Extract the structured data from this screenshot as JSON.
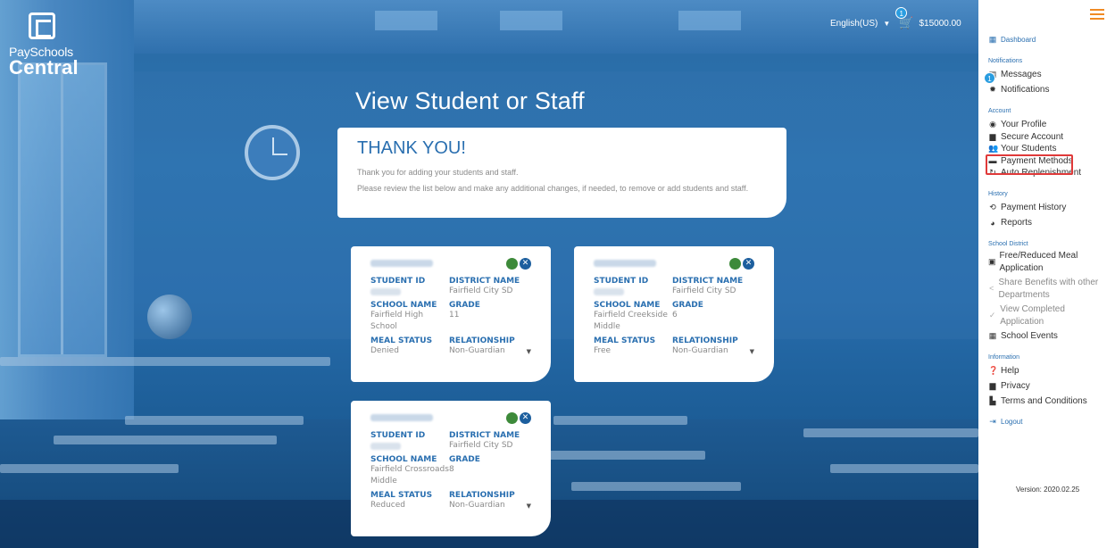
{
  "brand": {
    "line1": "PaySchools",
    "line2": "Central"
  },
  "topbar": {
    "language": "English(US)",
    "cart_total": "$15000.00",
    "cart_badge": "1"
  },
  "page": {
    "title": "View Student or Staff"
  },
  "thanks": {
    "heading": "THANK YOU!",
    "line1": "Thank you for adding your students and staff.",
    "line2": "Please review the list below and make any additional changes, if needed, to remove or add students and staff."
  },
  "labels": {
    "student_id": "STUDENT ID",
    "district_name": "DISTRICT NAME",
    "school_name": "SCHOOL NAME",
    "grade": "GRADE",
    "meal_status": "MEAL STATUS",
    "relationship": "RELATIONSHIP"
  },
  "students": [
    {
      "district": "Fairfield City SD",
      "school": "Fairfield High School",
      "grade": "11",
      "meal_status": "Denied",
      "relationship": "Non-Guardian"
    },
    {
      "district": "Fairfield City SD",
      "school": "Fairfield Creekside Middle",
      "grade": "6",
      "meal_status": "Free",
      "relationship": "Non-Guardian"
    },
    {
      "district": "Fairfield City SD",
      "school": "Fairfield Crossroads Middle",
      "grade": "8",
      "meal_status": "Reduced",
      "relationship": "Non-Guardian"
    }
  ],
  "sidebar": {
    "dashboard": "Dashboard",
    "sections": {
      "notifications": "Notifications",
      "account": "Account",
      "history": "History",
      "school_district": "School District",
      "information": "Information"
    },
    "messages_badge": "1",
    "items": {
      "messages": "Messages",
      "notifications": "Notifications",
      "your_profile": "Your Profile",
      "secure_account": "Secure Account",
      "your_students": "Your Students",
      "payment_methods": "Payment Methods",
      "auto_replenishment": "Auto Replenishment",
      "payment_history": "Payment History",
      "reports": "Reports",
      "free_reduced": "Free/Reduced Meal Application",
      "share_benefits": "Share Benefits with other Departments",
      "view_completed": "View Completed Application",
      "school_events": "School Events",
      "help": "Help",
      "privacy": "Privacy",
      "terms": "Terms and Conditions"
    },
    "logout": "Logout",
    "version": "Version: 2020.02.25"
  },
  "colors": {
    "accent": "#2a6fb0",
    "highlight": "#e03a3a",
    "menu": "#f08a24",
    "status_green": "#3d8a3a"
  }
}
